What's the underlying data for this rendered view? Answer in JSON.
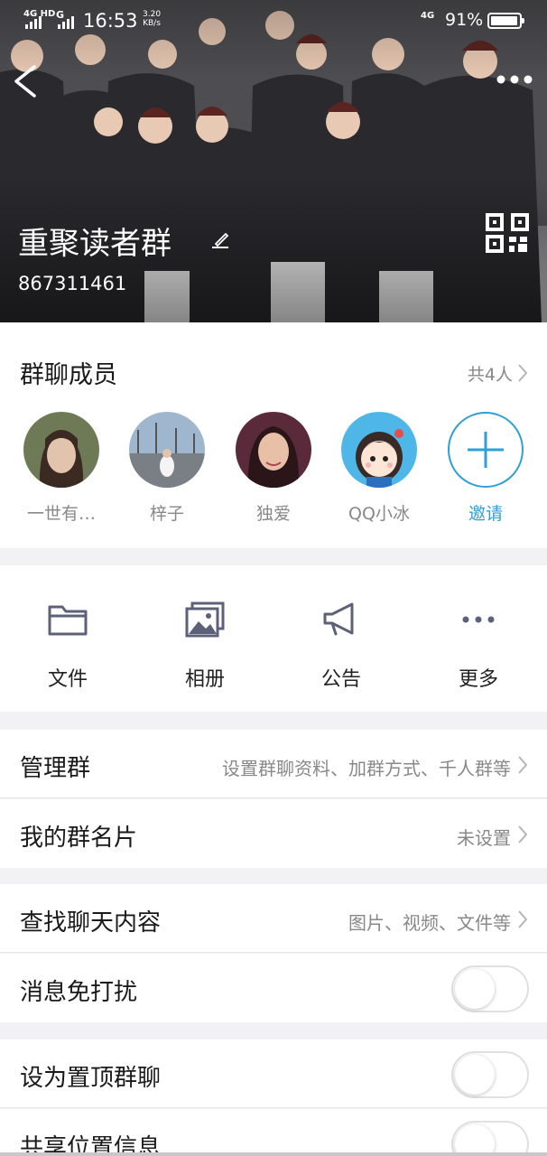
{
  "status_bar": {
    "network_1": "4G HD",
    "network_2": "G",
    "time": "16:53",
    "speed_value": "3.20",
    "speed_unit": "KB/s",
    "network_3": "4G",
    "battery_percent": "91%",
    "battery_level": 0.91
  },
  "header": {
    "group_name": "重聚读者群",
    "group_id": "867311461"
  },
  "members": {
    "title": "群聊成员",
    "count_label": "共4人",
    "items": [
      {
        "name": "一世有…"
      },
      {
        "name": "梓子"
      },
      {
        "name": "独爱"
      },
      {
        "name": "QQ小冰"
      }
    ],
    "invite_label": "邀请"
  },
  "features": {
    "items": [
      {
        "label": "文件",
        "icon": "folder-icon"
      },
      {
        "label": "相册",
        "icon": "album-icon"
      },
      {
        "label": "公告",
        "icon": "megaphone-icon"
      },
      {
        "label": "更多",
        "icon": "more-dots-icon"
      }
    ]
  },
  "settings": {
    "manage_group": {
      "label": "管理群",
      "value": "设置群聊资料、加群方式、千人群等"
    },
    "my_group_card": {
      "label": "我的群名片",
      "value": "未设置"
    },
    "search_chat": {
      "label": "查找聊天内容",
      "value": "图片、视频、文件等"
    },
    "do_not_disturb": {
      "label": "消息免打扰",
      "enabled": false
    },
    "pin_chat": {
      "label": "设为置顶群聊",
      "enabled": false
    },
    "share_location": {
      "label": "共享位置信息",
      "enabled": false
    }
  },
  "colors": {
    "accent": "#2fa0d5",
    "background": "#f2f2f5",
    "secondary_text": "#888888"
  }
}
